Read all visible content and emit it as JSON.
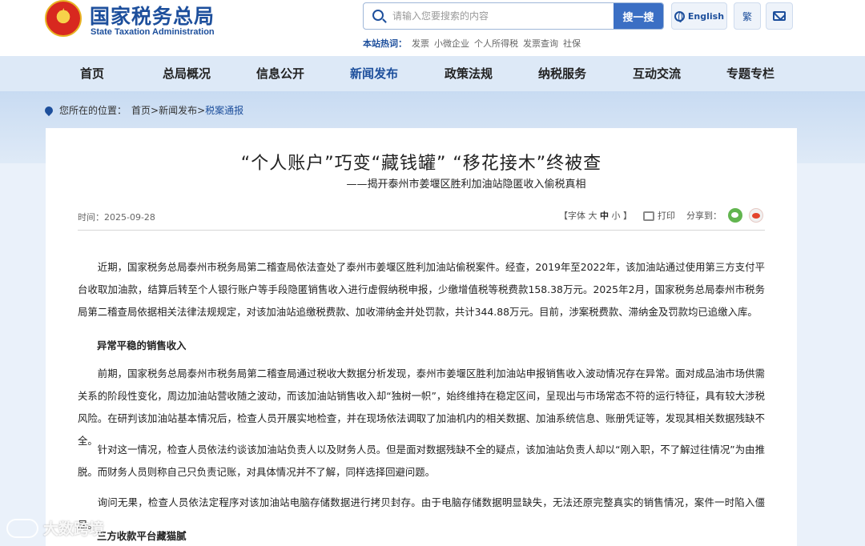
{
  "header": {
    "site_name_cn": "国家税务总局",
    "site_name_en": "State Taxation Administration",
    "search_placeholder": "请输入您要搜索的内容",
    "search_button": "搜一搜",
    "english_button": "English",
    "traditional_button": "繁",
    "hot_label": "本站热词：",
    "hot_words": [
      "发票",
      "小微企业",
      "个人所得税",
      "发票查询",
      "社保"
    ]
  },
  "nav": {
    "items": [
      "首页",
      "总局概况",
      "信息公开",
      "新闻发布",
      "政策法规",
      "纳税服务",
      "互动交流",
      "专题专栏"
    ],
    "active_index": 3
  },
  "breadcrumb": {
    "prefix": "您所在的位置：",
    "home": "首页",
    "sep": ">",
    "level1": "新闻发布",
    "current": "税案通报"
  },
  "article": {
    "title": "“个人账户”巧变“藏钱罐” “移花接木”终被查",
    "subtitle": "——揭开泰州市姜堰区胜利加油站隐匿收入偷税真相",
    "date": "时间：2025-09-28",
    "font_label": "【字体",
    "font_large": "大",
    "font_medium": "中",
    "font_small": "小",
    "font_close": "】",
    "print_label": "打印",
    "share_label": "分享到：",
    "paragraphs": [
      "近期，国家税务总局泰州市税务局第二稽查局依法查处了泰州市姜堰区胜利加油站偷税案件。经查，2019年至2022年，该加油站通过使用第三方支付平台收取加油款，结算后转至个人银行账户等手段隐匿销售收入进行虚假纳税申报，少缴增值税等税费款158.38万元。2025年2月，国家税务总局泰州市税务局第二稽查局依据相关法律法规规定，对该加油站追缴税费款、加收滞纳金并处罚款，共计344.88万元。目前，涉案税费款、滞纳金及罚款均已追缴入库。",
      "前期，国家税务总局泰州市税务局第二稽查局通过税收大数据分析发现，泰州市姜堰区胜利加油站申报销售收入波动情况存在异常。面对成品油市场供需关系的阶段性变化，周边加油站营收随之波动，而该加油站销售收入却“独树一帜”，始终维持在稳定区间，呈现出与市场常态不符的运行特征，具有较大涉税风险。在研判该加油站基本情况后，检查人员开展实地检查，并在现场依法调取了加油机内的相关数据、加油系统信息、账册凭证等，发现其相关数据残缺不全。",
      "针对这一情况，检查人员依法约谈该加油站负责人以及财务人员。但是面对数据残缺不全的疑点，该加油站负责人却以“刚入职，不了解过往情况”为由推脱。而财务人员则称自己只负责记账，对具体情况并不了解，同样选择回避问题。",
      "询问无果，检查人员依法定程序对该加油站电脑存储数据进行拷贝封存。由于电脑存储数据明显缺失，无法还原完整真实的销售情况，案件一时陷入僵局。"
    ],
    "headings": [
      "异常平稳的销售收入",
      "三方收款平台藏猫腻"
    ]
  },
  "watermark": "大数跨境",
  "colors": {
    "brand": "#1d4f9c",
    "nav_bg": "#dde9f7",
    "page_bg": "#eaf1fa",
    "search_button": "#3b6fc4"
  }
}
